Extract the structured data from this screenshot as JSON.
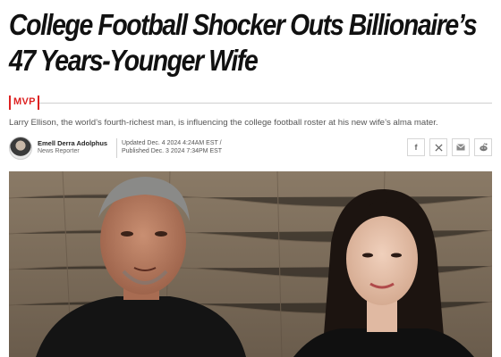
{
  "article": {
    "headline": "College Football Shocker Outs Billionaire’s 47 Years-Younger Wife",
    "section": "MVP",
    "dek": "Larry Ellison, the world’s fourth-richest man, is influencing the college football roster at his new wife’s alma mater.",
    "author": {
      "name": "Emell Derra Adolphus",
      "role": "News Reporter"
    },
    "updated": "Updated Dec. 4 2024 4:24AM EST /",
    "published": "Published Dec. 3 2024 7:34PM EST"
  },
  "share": [
    {
      "icon": "facebook-icon",
      "glyph": "f"
    },
    {
      "icon": "x-icon",
      "glyph": "𝕏"
    },
    {
      "icon": "email-icon",
      "glyph": "✉"
    },
    {
      "icon": "reddit-icon",
      "glyph": ""
    }
  ],
  "colors": {
    "accent": "#dd2222",
    "text": "#111111",
    "muted": "#555555"
  }
}
